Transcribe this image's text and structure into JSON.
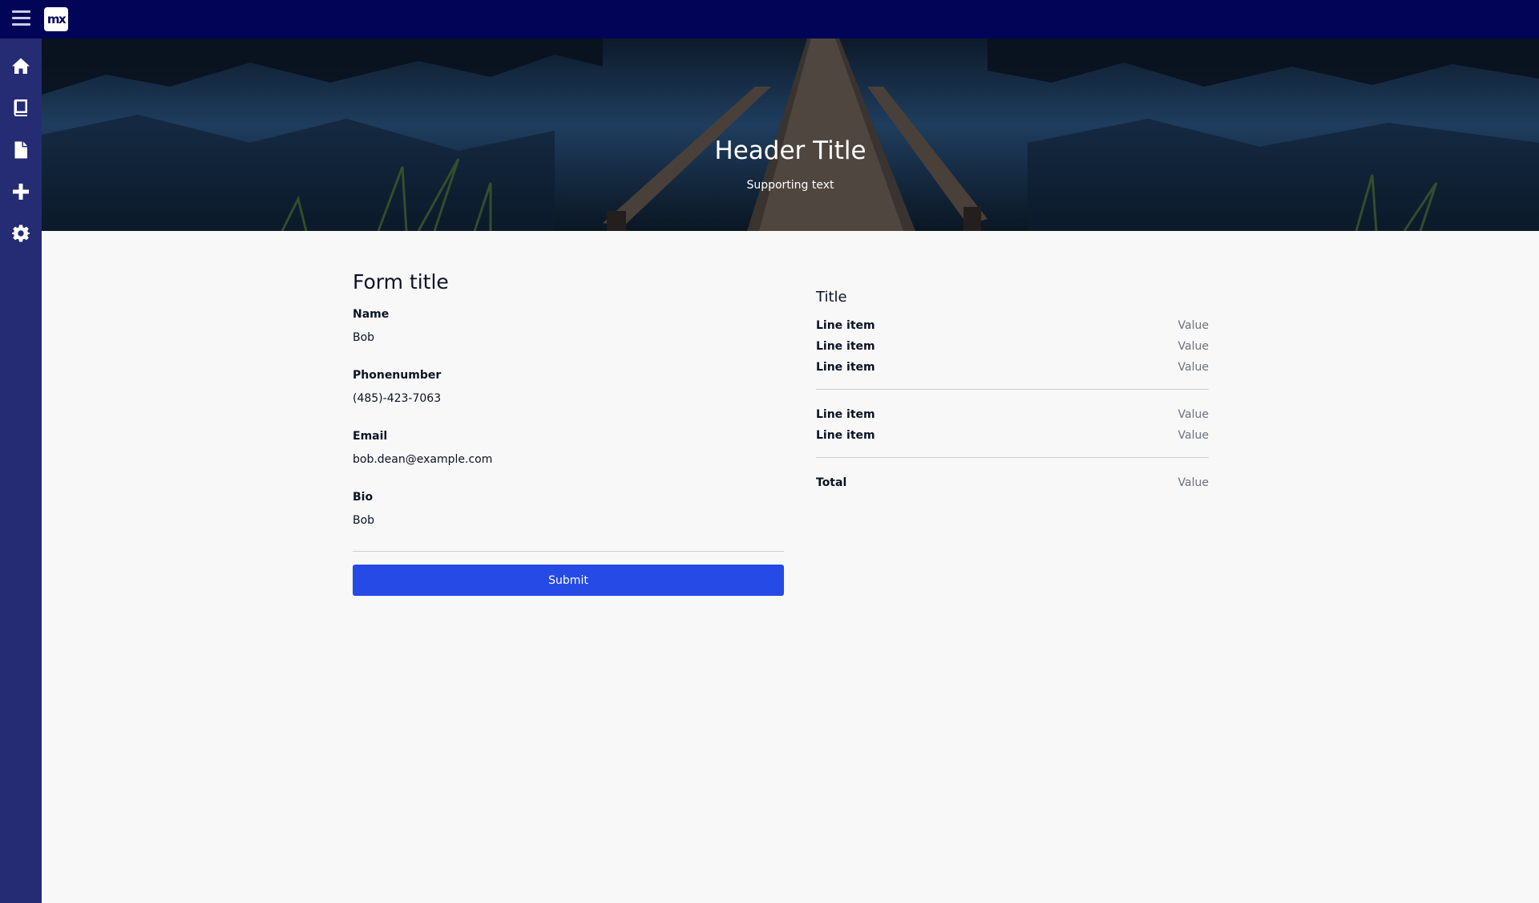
{
  "topbar": {
    "menu_icon": "hamburger-menu-icon",
    "logo_text": "mx"
  },
  "sidebar": {
    "items": [
      {
        "icon": "home-icon"
      },
      {
        "icon": "book-icon"
      },
      {
        "icon": "file-icon"
      },
      {
        "icon": "plus-icon"
      },
      {
        "icon": "gear-icon"
      }
    ]
  },
  "hero": {
    "title": "Header Title",
    "subtitle": "Supporting text"
  },
  "form": {
    "title": "Form title",
    "fields": [
      {
        "label": "Name",
        "value": "Bob"
      },
      {
        "label": "Phonenumber",
        "value": "(485)-423-7063"
      },
      {
        "label": "Email",
        "value": "bob.dean@example.com"
      },
      {
        "label": "Bio",
        "value": "Bob"
      }
    ],
    "submit_label": "Submit"
  },
  "summary": {
    "title": "Title",
    "group1": [
      {
        "label": "Line item",
        "value": "Value"
      },
      {
        "label": "Line item",
        "value": "Value"
      },
      {
        "label": "Line item",
        "value": "Value"
      }
    ],
    "group2": [
      {
        "label": "Line item",
        "value": "Value"
      },
      {
        "label": "Line item",
        "value": "Value"
      }
    ],
    "total": {
      "label": "Total",
      "value": "Value"
    }
  },
  "colors": {
    "topbar": "#020557",
    "sidebar": "#252c74",
    "primary_button": "#264ae5",
    "page_background": "#f8f8f8"
  }
}
